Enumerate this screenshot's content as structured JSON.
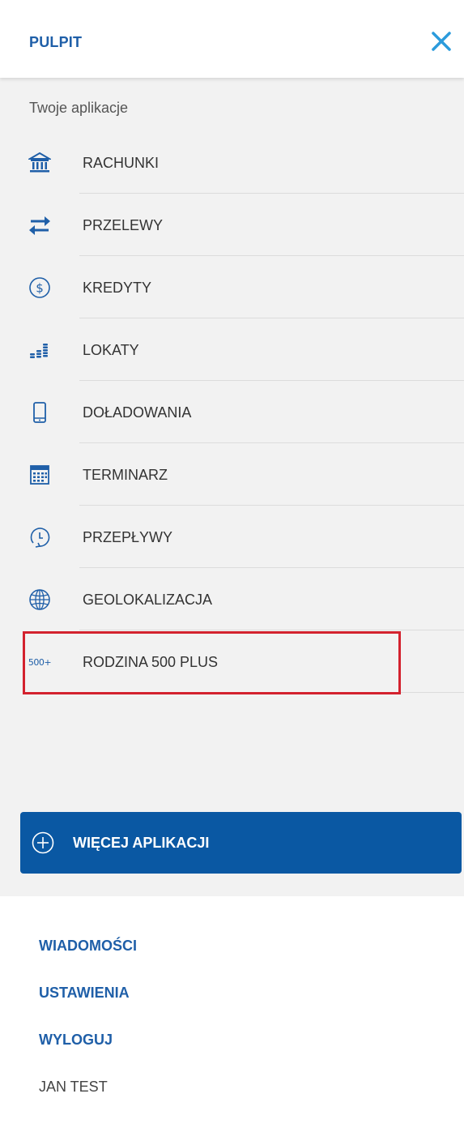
{
  "header": {
    "title": "PULPIT",
    "close_icon": "close-icon"
  },
  "apps": {
    "section_label": "Twoje aplikacje",
    "items": [
      {
        "label": "RACHUNKI",
        "icon": "bank-icon"
      },
      {
        "label": "PRZELEWY",
        "icon": "transfer-arrows-icon"
      },
      {
        "label": "KREDYTY",
        "icon": "dollar-coin-icon"
      },
      {
        "label": "LOKATY",
        "icon": "coin-stacks-icon"
      },
      {
        "label": "DOŁADOWANIA",
        "icon": "smartphone-icon"
      },
      {
        "label": "TERMINARZ",
        "icon": "calendar-icon"
      },
      {
        "label": "PRZEPŁYWY",
        "icon": "clock-cycle-icon"
      },
      {
        "label": "GEOLOKALIZACJA",
        "icon": "globe-icon"
      },
      {
        "label": "RODZINA 500 PLUS",
        "icon": "500-plus-icon",
        "icon_text": "500+",
        "highlighted": true
      }
    ],
    "more_button": {
      "label": "WIĘCEJ APLIKACJI",
      "icon": "plus-circle-icon"
    }
  },
  "footer": {
    "links": [
      "WIADOMOŚCI",
      "USTAWIENIA",
      "WYLOGUJ"
    ],
    "user": "JAN TEST"
  },
  "colors": {
    "accent": "#1f5fa8",
    "button_bg": "#0a58a3",
    "close_icon": "#2b9bdc",
    "highlight_border": "#d3222e",
    "panel_bg": "#f2f2f2"
  }
}
